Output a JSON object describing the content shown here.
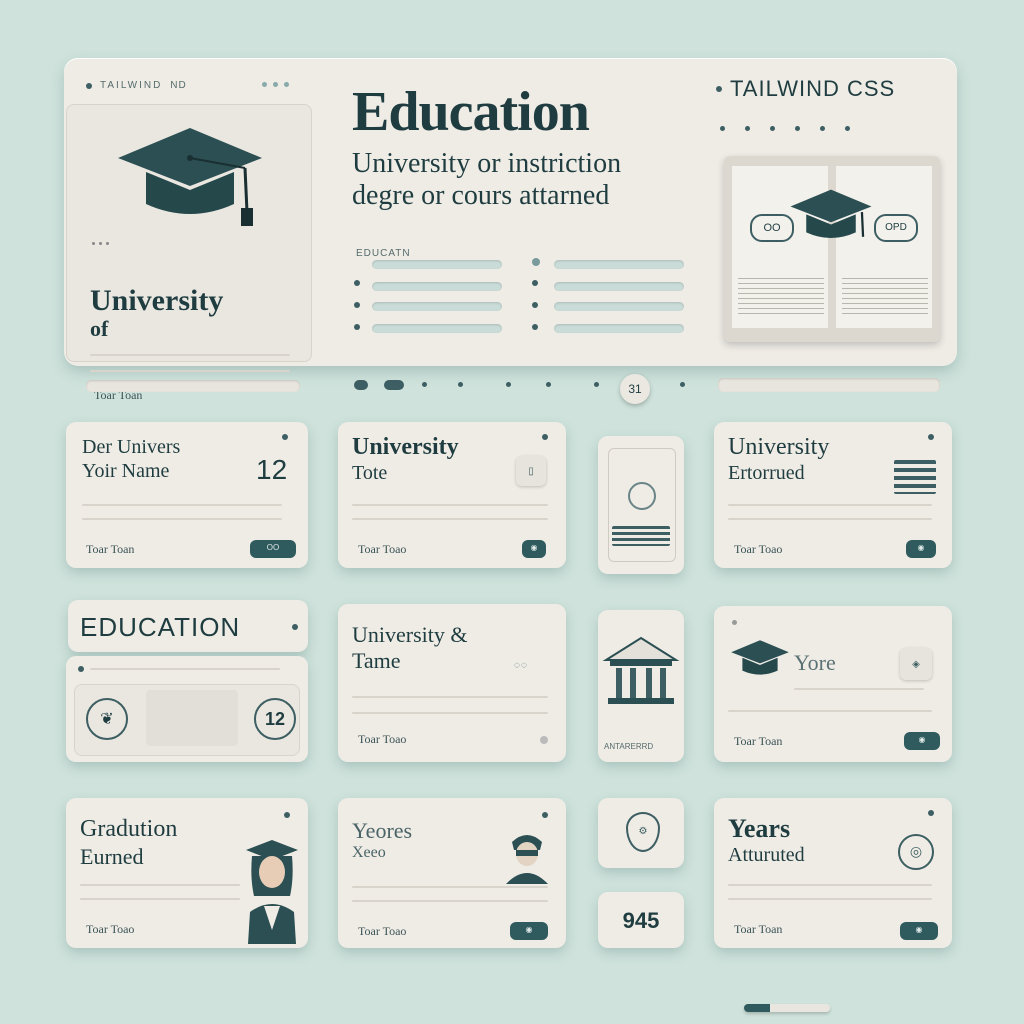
{
  "colors": {
    "background": "#cfe3dc",
    "panel": "#efece6",
    "accent": "#2f5a5e",
    "text": "#1f3d40"
  },
  "header": {
    "top_label": "TAILWIND",
    "top_right_small": "ND",
    "brand": "TAILWIND CSS",
    "title": "Education",
    "subtitle_line1": "University or instriction",
    "subtitle_line2": "degre or cours attarned",
    "left_card": {
      "title_line1": "University",
      "title_line2": "of",
      "footer": "Toar Toan"
    },
    "list_label": "EDUCATN",
    "book_left_badge": "OO",
    "book_right_badge": "OPD"
  },
  "toolbar": {
    "badge": "31"
  },
  "cards": [
    {
      "title_line1": "Der Univers",
      "title_line2": "Yoir Name",
      "number": "12",
      "footer": "Toar Toan",
      "button": "OO"
    },
    {
      "title_line1": "University",
      "title_line2": "Tote",
      "footer": "Toar Toao"
    },
    {
      "title_line1": "University",
      "title_line2": "Ertorrued",
      "footer": "Toar Toao"
    },
    {
      "tab_label": "EDUCATION",
      "number": "12"
    },
    {
      "title_line1": "University &",
      "title_line2": "Tame",
      "footer": "Toar Toao"
    },
    {
      "museum_caption": "ANTARERRD"
    },
    {
      "title_line1": "Yore",
      "footer": "Toar Toan"
    },
    {
      "title_line1": "Gradution",
      "title_line2": "Eurned",
      "footer": "Toar Toao"
    },
    {
      "title_line1": "Yeores",
      "title_line2": "Xeeo",
      "footer": "Toar Toao"
    },
    {
      "number": "945"
    },
    {
      "title_line1": "Years",
      "title_line2": "Atturuted",
      "footer": "Toar Toan"
    }
  ]
}
